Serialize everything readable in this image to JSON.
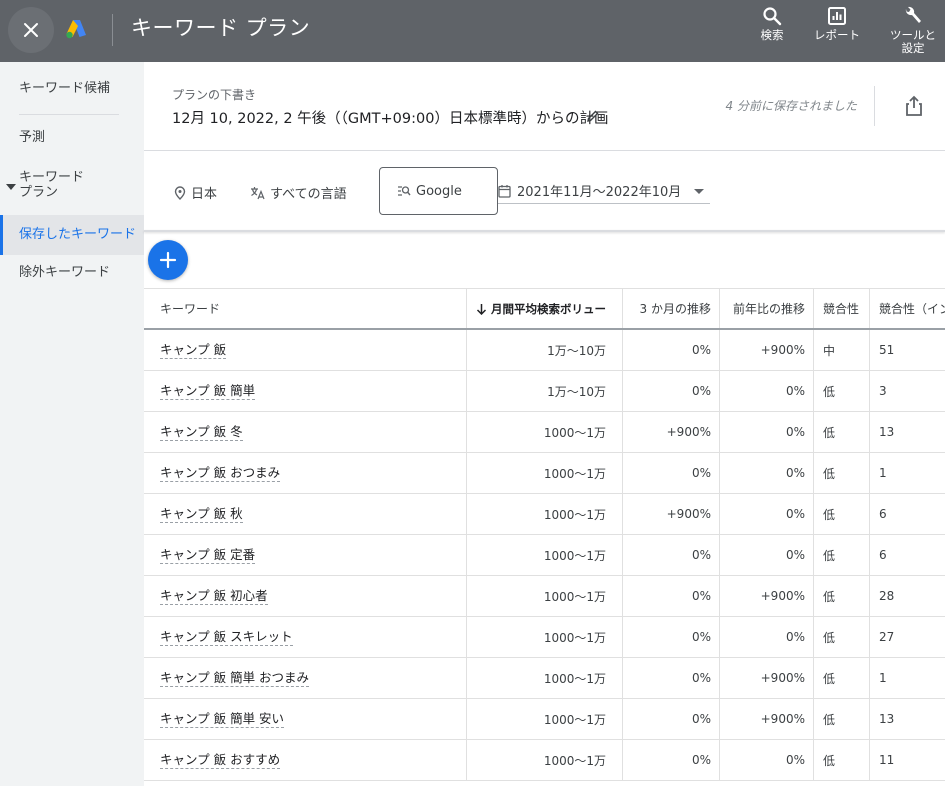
{
  "header": {
    "title": "キーワード プラン",
    "actions": [
      {
        "label": "検索",
        "icon": "search-icon"
      },
      {
        "label": "レポート",
        "icon": "reports-icon"
      },
      {
        "label": "ツールと設定",
        "label_line1": "ツールと",
        "label_line2": "設定",
        "icon": "wrench-icon"
      }
    ]
  },
  "sidebar": {
    "items": [
      {
        "label": "キーワード候補"
      },
      {
        "label": "予測"
      },
      {
        "label": "キーワードプラン",
        "label_line1": "キーワード",
        "label_line2": "プラン",
        "expanded": true
      },
      {
        "label": "保存したキーワード",
        "active": true
      },
      {
        "label": "除外キーワード"
      }
    ]
  },
  "plan": {
    "draft_label": "プランの下書き",
    "title": "12月 10, 2022, 2 午後（（GMT+09:00）日本標準時）からの計画",
    "saved_status": "4 分前に保存されました"
  },
  "filters": {
    "location": "日本",
    "language": "すべての言語",
    "network": "Google",
    "date_range": "2021年11月～2022年10月"
  },
  "table": {
    "columns": [
      "キーワード",
      "月間平均検索ボリュー",
      "3 か月の推移",
      "前年比の推移",
      "競合性",
      "競合性（イン"
    ],
    "rows": [
      [
        "キャンプ 飯",
        "1万～10万",
        "0%",
        "+900%",
        "中",
        "51"
      ],
      [
        "キャンプ 飯 簡単",
        "1万～10万",
        "0%",
        "0%",
        "低",
        "3"
      ],
      [
        "キャンプ 飯 冬",
        "1000～1万",
        "+900%",
        "0%",
        "低",
        "13"
      ],
      [
        "キャンプ 飯 おつまみ",
        "1000～1万",
        "0%",
        "0%",
        "低",
        "1"
      ],
      [
        "キャンプ 飯 秋",
        "1000～1万",
        "+900%",
        "0%",
        "低",
        "6"
      ],
      [
        "キャンプ 飯 定番",
        "1000～1万",
        "0%",
        "0%",
        "低",
        "6"
      ],
      [
        "キャンプ 飯 初心者",
        "1000～1万",
        "0%",
        "+900%",
        "低",
        "28"
      ],
      [
        "キャンプ 飯 スキレット",
        "1000～1万",
        "0%",
        "0%",
        "低",
        "27"
      ],
      [
        "キャンプ 飯 簡単 おつまみ",
        "1000～1万",
        "0%",
        "+900%",
        "低",
        "1"
      ],
      [
        "キャンプ 飯 簡単 安い",
        "1000～1万",
        "0%",
        "+900%",
        "低",
        "13"
      ],
      [
        "キャンプ 飯 おすすめ",
        "1000～1万",
        "0%",
        "0%",
        "低",
        "11"
      ]
    ]
  },
  "colors": {
    "topbar": "#5f6368",
    "accent": "#1a73e8",
    "sidebar_bg": "#f1f3f4"
  }
}
